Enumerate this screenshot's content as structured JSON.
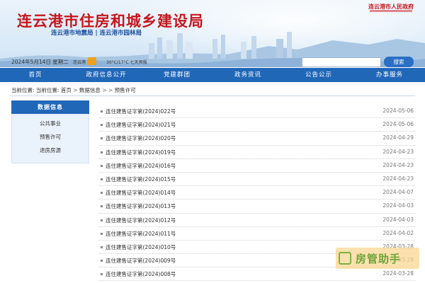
{
  "header": {
    "title": "连云港市住房和城乡建设局",
    "subtitle": "连云港市地震局 | 连云港市园林局",
    "gov_badge": "连云港市人民政府"
  },
  "info_bar": {
    "date": "2024年5月14日 星期二",
    "city": "连云港",
    "weather": "30°C/17°C  七天预报",
    "search_placeholder": "",
    "search_button": "搜索"
  },
  "nav": {
    "items": [
      {
        "label": "首页"
      },
      {
        "label": "政府信息公开"
      },
      {
        "label": "党建群团"
      },
      {
        "label": "政务资讯"
      },
      {
        "label": "公告公示"
      },
      {
        "label": "办事服务"
      }
    ]
  },
  "breadcrumb": {
    "label": "当前位置:",
    "items": [
      "首页",
      "数据信息",
      "预售许可"
    ],
    "sep": ">"
  },
  "sidebar": {
    "header": "数据信息",
    "items": [
      {
        "label": "公共事业"
      },
      {
        "label": "预售许可"
      },
      {
        "label": "退房房源"
      }
    ]
  },
  "list": {
    "rows": [
      {
        "title": "连住建售证字第(2024)022号",
        "date": "2024-05-06"
      },
      {
        "title": "连住建售证字第(2024)021号",
        "date": "2024-05-06"
      },
      {
        "title": "连住建售证字第(2024)020号",
        "date": "2024-04-29"
      },
      {
        "title": "连住建售证字第(2024)019号",
        "date": "2024-04-23"
      },
      {
        "title": "连住建售证字第(2024)016号",
        "date": "2024-04-23"
      },
      {
        "title": "连住建售证字第(2024)015号",
        "date": "2024-04-23"
      },
      {
        "title": "连住建售证字第(2024)014号",
        "date": "2024-04-07"
      },
      {
        "title": "连住建售证字第(2024)013号",
        "date": "2024-04-03"
      },
      {
        "title": "连住建售证字第(2024)012号",
        "date": "2024-04-03"
      },
      {
        "title": "连住建售证字第(2024)011号",
        "date": "2024-04-02"
      },
      {
        "title": "连住建售证字第(2024)010号",
        "date": "2024-03-28"
      },
      {
        "title": "连住建售证字第(2024)009号",
        "date": "2024-03-28"
      },
      {
        "title": "连住建售证字第(2024)008号",
        "date": "2024-03-28"
      }
    ]
  },
  "watermark": {
    "text": "房管助手"
  },
  "colors": {
    "brand_red": "#c8161d",
    "nav_blue": "#2167b8",
    "sidebar_bg": "#eaf2fb"
  }
}
